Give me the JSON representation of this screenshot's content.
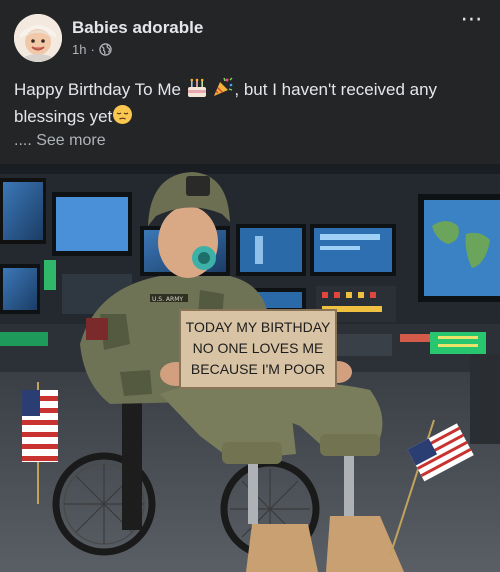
{
  "post": {
    "author": "Babies adorable",
    "time": "1h",
    "separator": "·",
    "caption_part1": "Happy Birthday To Me",
    "caption_part2": ", but I haven't received any blessings yet",
    "see_more": ".... See more",
    "more_icon": "⋯"
  },
  "photo": {
    "sign_line1": "TODAY MY BIRTHDAY",
    "sign_line2": "NO ONE LOVES ME",
    "sign_line3": "BECAUSE  I'M POOR",
    "badge": "U.S. ARMY"
  },
  "icons": {
    "globe": "globe-icon",
    "cake": "birthday-cake-icon",
    "party": "party-popper-icon",
    "sad": "pensive-face-icon"
  },
  "colors": {
    "background": "#242526",
    "text": "#e4e6eb",
    "secondary": "#b0b3b8"
  }
}
